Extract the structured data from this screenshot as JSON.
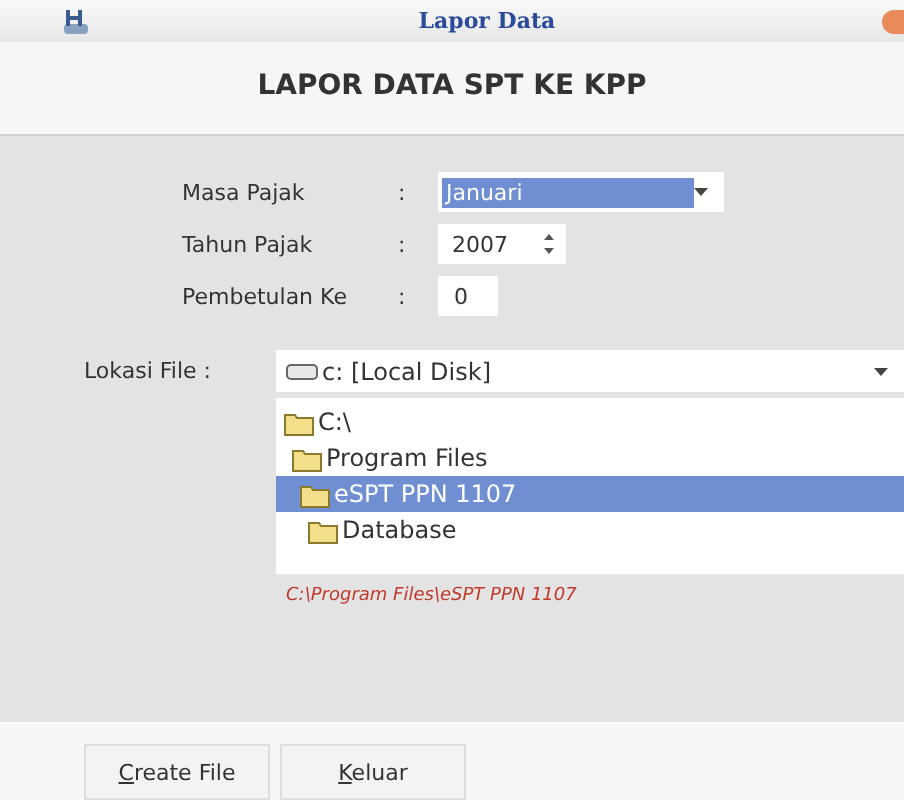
{
  "window": {
    "title": "Lapor Data"
  },
  "heading": "LAPOR DATA SPT KE KPP",
  "fields": [
    {
      "kind": "dropdown",
      "label": "Masa Pajak",
      "separator": ":",
      "value": "Januari",
      "selected": true
    },
    {
      "kind": "spinner",
      "label": "Tahun Pajak",
      "separator": ":",
      "value": "2007",
      "selected": false
    },
    {
      "kind": "text",
      "label": "Pembetulan Ke",
      "separator": ":",
      "value": "0",
      "selected": false
    }
  ],
  "location": {
    "label": "Lokasi File :",
    "drive": "c: [Local Disk]"
  },
  "folders": [
    {
      "name": "C:\\",
      "selected": false,
      "children": [
        {
          "name": "Program Files",
          "selected": false,
          "children": [
            {
              "name": "eSPT PPN 1107",
              "selected": true,
              "children": [
                {
                  "name": "Database",
                  "selected": false
                }
              ]
            }
          ]
        }
      ]
    }
  ],
  "path": "C:\\Program Files\\eSPT PPN 1107",
  "buttons": [
    {
      "label": "Create File",
      "underline_first": true
    },
    {
      "label": "Keluar",
      "underline_first": true
    }
  ]
}
